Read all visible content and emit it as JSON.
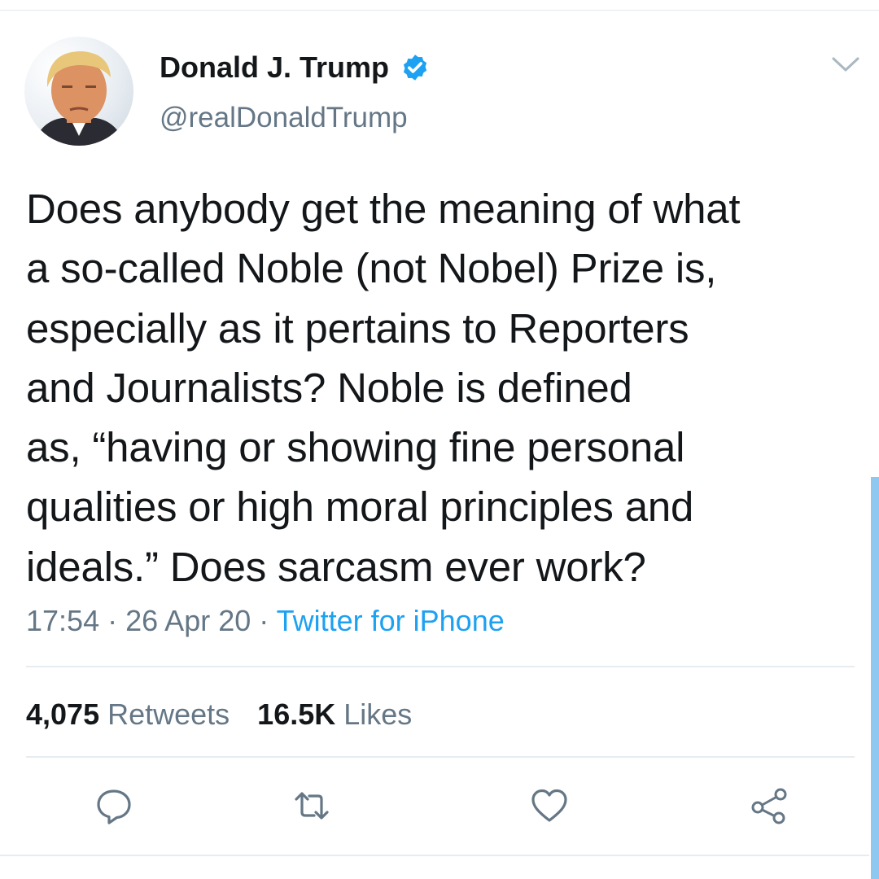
{
  "author": {
    "display_name": "Donald J. Trump",
    "handle": "@realDonaldTrump",
    "verified_icon": "verified-badge-icon"
  },
  "tweet": {
    "text": "Does anybody get the meaning of what\na so-called Noble (not Nobel) Prize is,\nespecially as it pertains to Reporters\nand Journalists? Noble is defined\nas, “having or showing fine personal\nqualities or high moral principles and\nideals.” Does sarcasm ever work?"
  },
  "meta": {
    "time": "17:54",
    "date": "26 Apr 20",
    "separator": "·",
    "source": "Twitter for iPhone"
  },
  "stats": {
    "retweets_count": "4,075",
    "retweets_label": "Retweets",
    "likes_count": "16.5K",
    "likes_label": "Likes"
  },
  "actions": [
    {
      "icon": "reply-icon"
    },
    {
      "icon": "retweet-icon"
    },
    {
      "icon": "like-icon"
    },
    {
      "icon": "share-icon"
    }
  ],
  "colors": {
    "text": "#14171a",
    "secondary": "#657786",
    "accent": "#1da1f2",
    "divider": "#e6ecf0"
  }
}
